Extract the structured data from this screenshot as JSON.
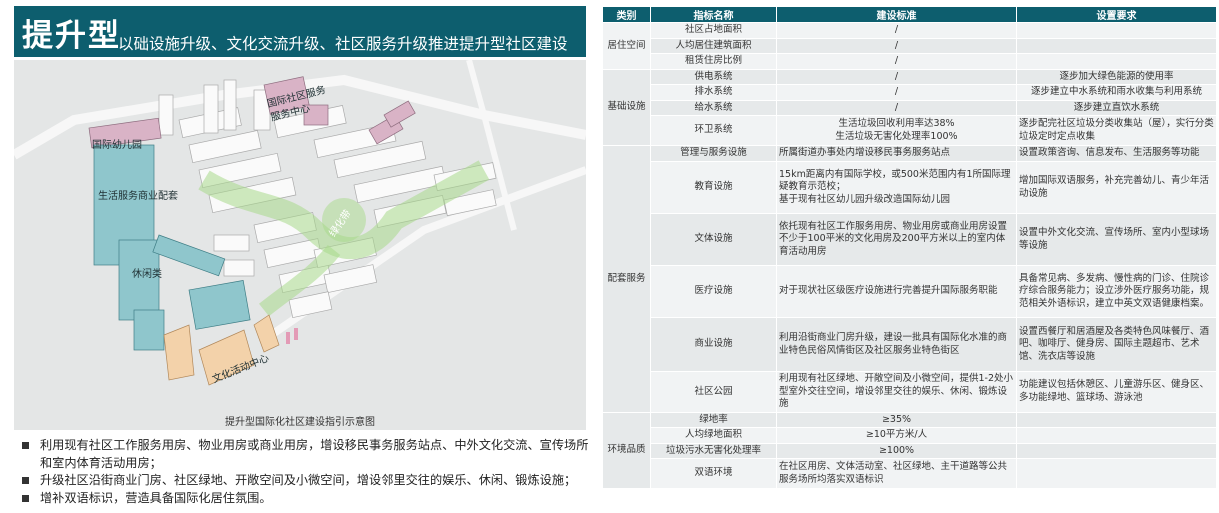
{
  "header": {
    "title": "提升型",
    "subtitle": "以础设施升级、文化交流升级、社区服务升级推进提升型社区建设"
  },
  "map": {
    "labels": {
      "kindergarten": "国际幼儿园",
      "service_center": "生活服务商业配套",
      "leisure": "休闲类",
      "culture_center": "文化活动中心",
      "green_axis": "绿化带",
      "top_label_1": "国际社区服务",
      "top_label_2": "服务中心"
    },
    "caption": "提升型国际化社区建设指引示意图"
  },
  "bullets": [
    "利用现有社区工作服务用房、物业用房或商业用房，增设移民事务服务站点、中外文化交流、宣传场所和室内体育活动用房；",
    "升级社区沿街商业门房、社区绿地、开敞空间及小微空间，增设邻里交往的娱乐、休闲、锻炼设施；",
    "增补双语标识，营造具备国际化居住氛围。"
  ],
  "table": {
    "headers": [
      "类别",
      "指标名称",
      "建设标准",
      "设置要求"
    ],
    "cats": {
      "live": "居住空间",
      "infra": "基础设施",
      "service": "配套服务",
      "env": "环境品质"
    },
    "rows": [
      {
        "name": "社区占地面积",
        "std": "/",
        "req": ""
      },
      {
        "name": "人均居住建筑面积",
        "std": "/",
        "req": ""
      },
      {
        "name": "租赁住房比例",
        "std": "/",
        "req": ""
      },
      {
        "name": "供电系统",
        "std": "/",
        "req": "逐步加大绿色能源的使用率"
      },
      {
        "name": "排水系统",
        "std": "/",
        "req": "逐步建立中水系统和雨水收集与利用系统"
      },
      {
        "name": "给水系统",
        "std": "/",
        "req": "逐步建立直饮水系统"
      },
      {
        "name": "环卫系统",
        "std": "生活垃圾回收利用率达38%\n生活垃圾无害化处理率100%",
        "req": "逐步配完社区垃圾分类收集站（屋），实行分类垃圾定时定点收集"
      },
      {
        "name": "管理与服务设施",
        "std": "所属街道办事处内增设移民事务服务站点",
        "req": "设置政策咨询、信息发布、生活服务等功能"
      },
      {
        "name": "教育设施",
        "std": "15km距离内有国际学校，或500米范围内有1所国际理疑教育示范校；\n基于现有社区幼儿园升级改造国际幼儿园",
        "req": "增加国际双语服务，补充完善幼儿、青少年活动设施"
      },
      {
        "name": "文体设施",
        "std": "依托现有社区工作服务用房、物业用房或商业用房设置不少于100平米的文化用房及200平方米以上的室内体育活动用房",
        "req": "设置中外文化交流、宣传场所、室内小型球场等设施"
      },
      {
        "name": "医疗设施",
        "std": "对于现状社区级医疗设施进行完善提升国际服务职能",
        "req": "具备常见病、多发病、慢性病的门诊、住院诊疗综合服务能力；设立涉外医疗服务功能，规范相关外语标识，建立中英文双语健康档案。"
      },
      {
        "name": "商业设施",
        "std": "利用沿街商业门房升级，建设一批具有国际化水准的商业特色民俗风情街区及社区服务业特色街区",
        "req": "设置西餐厅和居酒屋及各类特色风味餐厅、酒吧、咖啡厅、健身房、国际主题超市、艺术馆、洗衣店等设施"
      },
      {
        "name": "社区公园",
        "std": "利用现有社区绿地、开敞空间及小微空间，提供1-2处小型室外交往空间，增设邻里交往的娱乐、休闲、锻炼设施",
        "req": "功能建议包括休憩区、儿童游乐区、健身区、多功能绿地、篮球场、游泳池"
      },
      {
        "name": "绿地率",
        "std": "≥35%",
        "req": ""
      },
      {
        "name": "人均绿地面积",
        "std": "≥10平方米/人",
        "req": ""
      },
      {
        "name": "垃圾污水无害化处理率",
        "std": "≥100%",
        "req": ""
      },
      {
        "name": "双语环境",
        "std": "在社区用房、文体活动室、社区绿地、主干道路等公共服务场所均落实双语标识",
        "req": ""
      }
    ]
  },
  "colors": {
    "header_bg": "#0d5e6e",
    "building_teal": "#8fc6cc",
    "building_pink": "#d9b3c6",
    "building_orange": "#f3d2aa",
    "green_axis": "#a8d98a"
  }
}
